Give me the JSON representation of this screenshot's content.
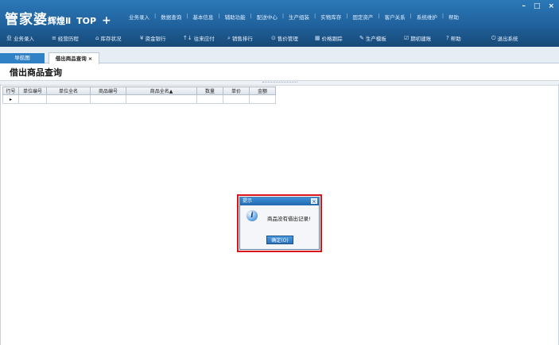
{
  "app": {
    "logo_text": "管家婆",
    "logo_sub": "辉煌Ⅱ",
    "logo_version": "TOP",
    "logo_plus": "+"
  },
  "menu": [
    "业务录入",
    "数据查询",
    "基本信息",
    "辅助功能",
    "配送中心",
    "生产组装",
    "实物库存",
    "固定资产",
    "客户关系",
    "系统维护",
    "帮助"
  ],
  "window_controls": {
    "minimize": "–",
    "maximize": "□",
    "close": "×"
  },
  "toolbar": [
    {
      "icon": "业",
      "label": "业务录入"
    },
    {
      "icon": "≡",
      "label": "经营历程"
    },
    {
      "icon": "⌂",
      "label": "库存状况"
    },
    {
      "icon": "¥",
      "label": "资金银行"
    },
    {
      "icon": "↑↓",
      "label": "往来应付"
    },
    {
      "icon": "⌕",
      "label": "销售排行"
    },
    {
      "icon": "⊙",
      "label": "售价管理"
    },
    {
      "icon": "▦",
      "label": "价格跟踪"
    },
    {
      "icon": "✎",
      "label": "生产模板"
    },
    {
      "icon": "☑",
      "label": "期初建账"
    },
    {
      "icon": "?",
      "label": "帮助"
    },
    {
      "icon": "⏻",
      "label": "退出系统"
    }
  ],
  "tabs": {
    "nav_label": "导航图",
    "active_label": "借出商品查询",
    "close_glyph": "×"
  },
  "page_title": "借出商品查询",
  "grid": {
    "columns": [
      "行号",
      "单位编号",
      "单位全名",
      "商品编号",
      "商品全名▲",
      "数量",
      "单价",
      "金额"
    ],
    "row_indicator": "▸"
  },
  "dialog": {
    "title": "提示",
    "close_glyph": "×",
    "icon_glyph": "i",
    "message": "商品没有借出记录!",
    "ok_label": "确定(O)"
  }
}
